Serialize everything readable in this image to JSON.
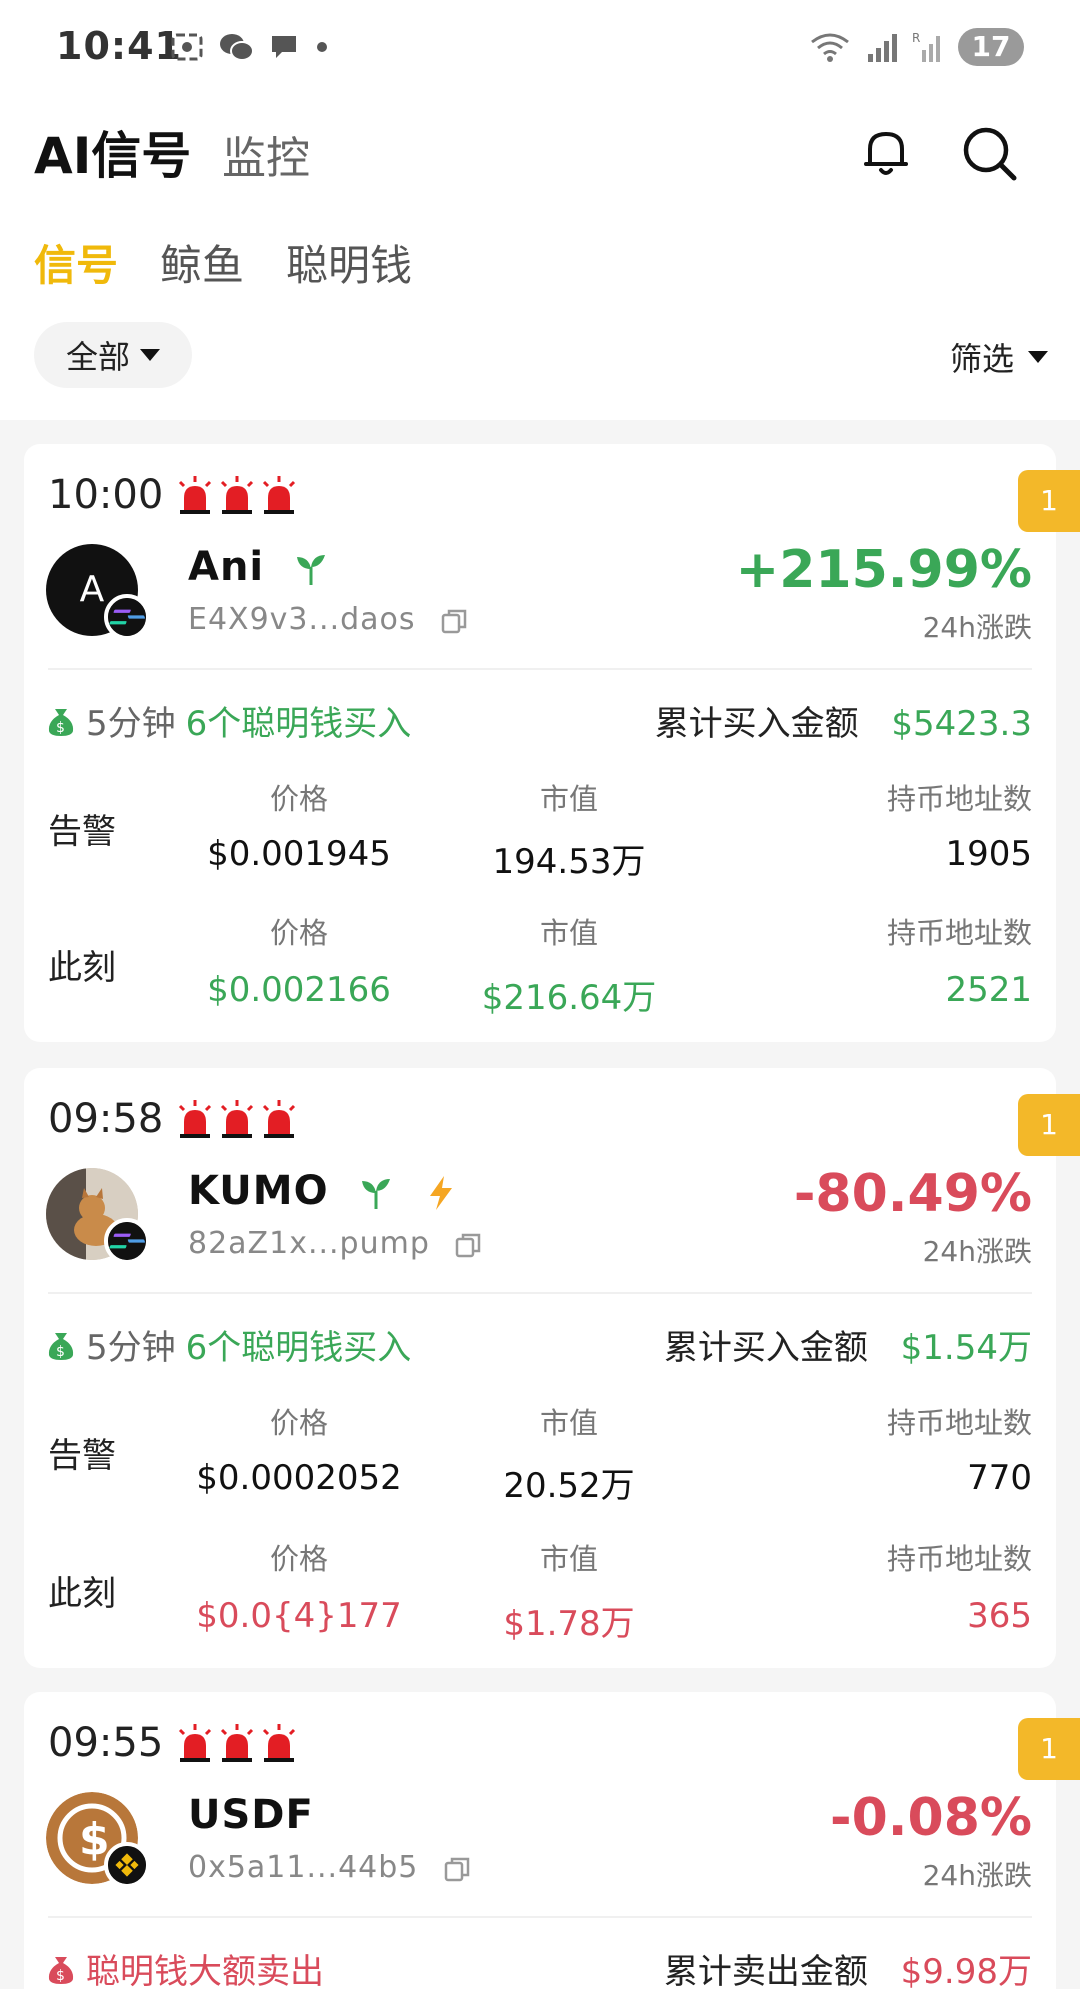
{
  "status_bar": {
    "time": "10:41",
    "battery": "17"
  },
  "header": {
    "title": "AI信号",
    "tab_monitor": "监控"
  },
  "sub_tabs": [
    "信号",
    "鲸鱼",
    "聪明钱"
  ],
  "filters": {
    "all": "全部",
    "screen": "筛选"
  },
  "cards": [
    {
      "time": "10:00",
      "badge": "1",
      "avatar_letter": "A",
      "name": "Ani",
      "address": "E4X9v3...daos",
      "change": "+215.99%",
      "change_label": "24h涨跌",
      "action_time": "5分钟",
      "action_text": "6个聪明钱买入",
      "total_label": "累计买入金额",
      "total_value": "$5423.3",
      "alert_label": "告警",
      "now_label": "此刻",
      "h_price": "价格",
      "h_mcap": "市值",
      "h_holders": "持币地址数",
      "alert_price": "$0.001945",
      "alert_mcap": "194.53万",
      "alert_holders": "1905",
      "now_price": "$0.002166",
      "now_mcap": "$216.64万",
      "now_holders": "2521"
    },
    {
      "time": "09:58",
      "badge": "1",
      "name": "KUMO",
      "address": "82aZ1x...pump",
      "change": "-80.49%",
      "change_label": "24h涨跌",
      "action_time": "5分钟",
      "action_text": "6个聪明钱买入",
      "total_label": "累计买入金额",
      "total_value": "$1.54万",
      "alert_label": "告警",
      "now_label": "此刻",
      "h_price": "价格",
      "h_mcap": "市值",
      "h_holders": "持币地址数",
      "alert_price": "$0.0002052",
      "alert_mcap": "20.52万",
      "alert_holders": "770",
      "now_price": "$0.0{4}177",
      "now_mcap": "$1.78万",
      "now_holders": "365"
    },
    {
      "time": "09:55",
      "badge": "1",
      "name": "USDF",
      "address": "0x5a11...44b5",
      "change": "-0.08%",
      "change_label": "24h涨跌",
      "action_text": "聪明钱大额卖出",
      "total_label": "累计卖出金额",
      "total_value": "$9.98万"
    }
  ],
  "colors": {
    "accent": "#f0b90b",
    "up": "#3aa757",
    "down": "#d94b5b",
    "badge": "#f3b829"
  }
}
